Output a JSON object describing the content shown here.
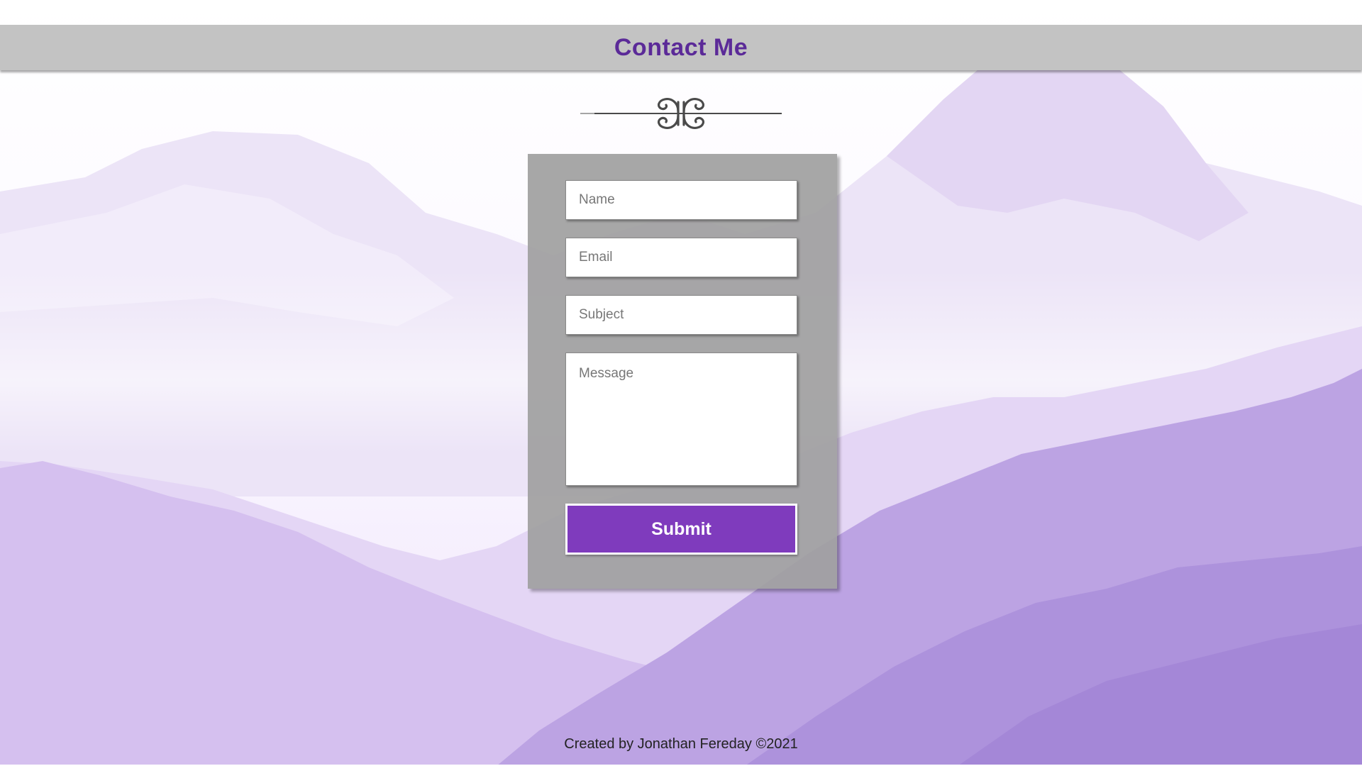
{
  "header": {
    "title": "Contact Me"
  },
  "divider": {
    "icon": "ornament-flourish-icon"
  },
  "form": {
    "name_placeholder": "Name",
    "email_placeholder": "Email",
    "subject_placeholder": "Subject",
    "message_placeholder": "Message",
    "submit_label": "Submit"
  },
  "footer": {
    "credit": "Created by Jonathan Fereday ©2021"
  },
  "colors": {
    "title": "#5b2a98",
    "header_bg": "#c3c3c3",
    "card_bg": "#a0a0a0",
    "submit_bg": "#7f3bbd",
    "mountain_tint": "#b89be0"
  }
}
